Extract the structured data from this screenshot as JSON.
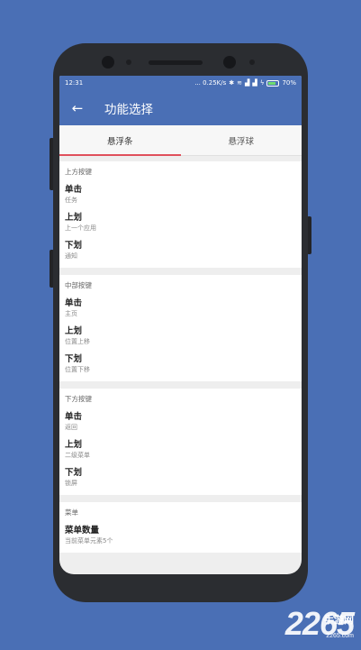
{
  "status_bar": {
    "time": "12:31",
    "network_speed": "... 0.25K/s",
    "battery": "70%"
  },
  "app_bar": {
    "title": "功能选择"
  },
  "tabs": [
    {
      "label": "悬浮条",
      "active": true
    },
    {
      "label": "悬浮球",
      "active": false
    }
  ],
  "sections": [
    {
      "title": "上方按键",
      "items": [
        {
          "label": "单击",
          "value": "任务"
        },
        {
          "label": "上划",
          "value": "上一个应用"
        },
        {
          "label": "下划",
          "value": "通知"
        }
      ]
    },
    {
      "title": "中部按键",
      "items": [
        {
          "label": "单击",
          "value": "主页"
        },
        {
          "label": "上划",
          "value": "位置上移"
        },
        {
          "label": "下划",
          "value": "位置下移"
        }
      ]
    },
    {
      "title": "下方按键",
      "items": [
        {
          "label": "单击",
          "value": "返回"
        },
        {
          "label": "上划",
          "value": "二级菜单"
        },
        {
          "label": "下划",
          "value": "锁屏"
        }
      ]
    },
    {
      "title": "菜单",
      "items": [
        {
          "label": "菜单数量",
          "value": "当前菜单元素5个"
        }
      ]
    }
  ],
  "watermark": {
    "number": "2265",
    "text": "手游网",
    "domain": "2265.com"
  },
  "colors": {
    "primary": "#4a6fb5",
    "tab_indicator": "#e0505c"
  }
}
